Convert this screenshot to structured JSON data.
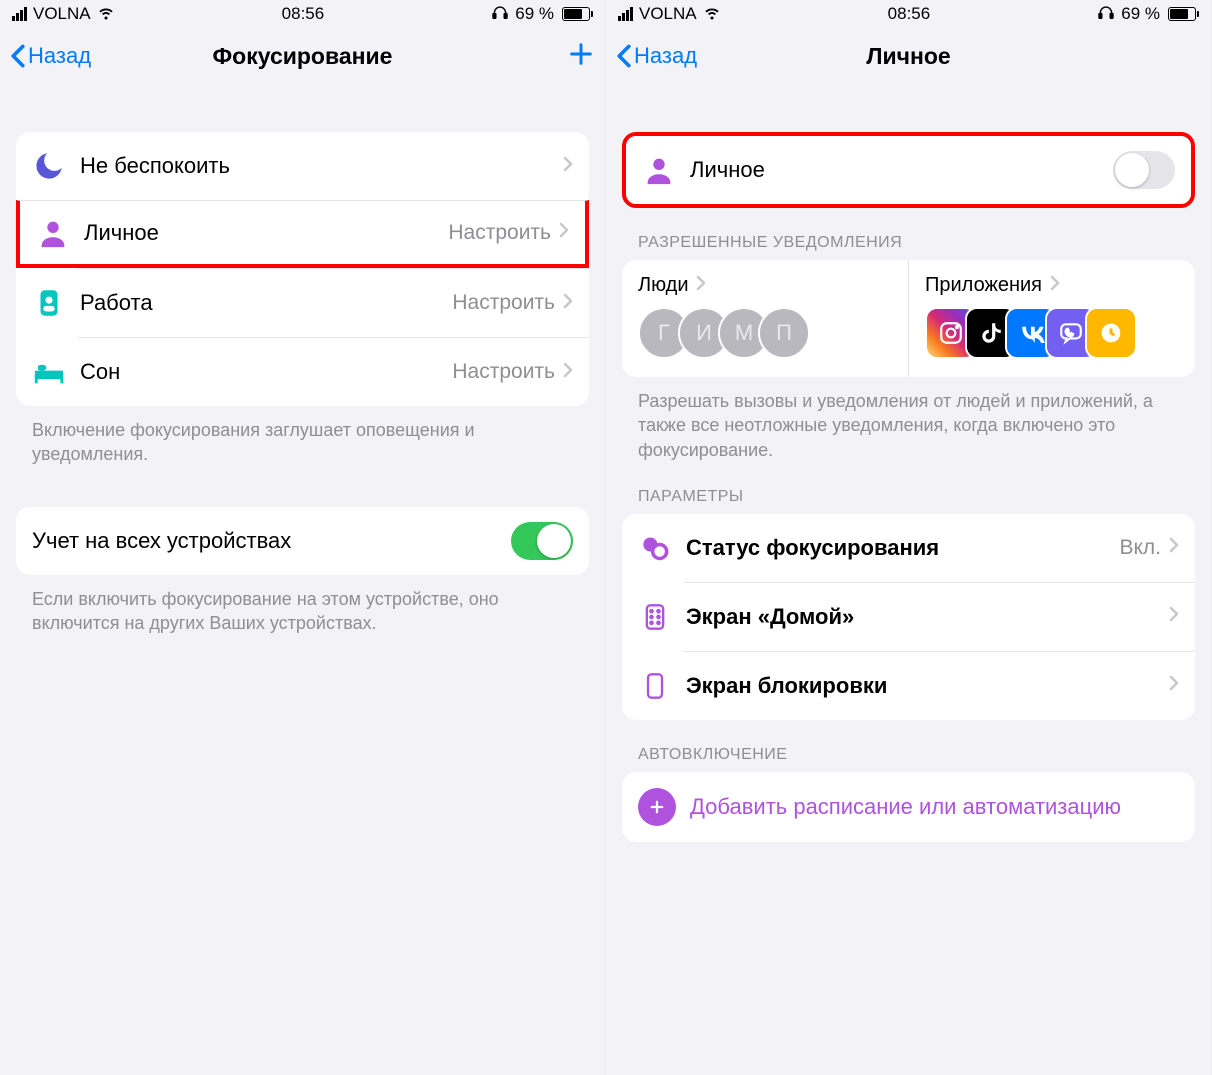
{
  "status": {
    "carrier": "VOLNA",
    "time": "08:56",
    "battery_pct": "69 %",
    "battery_fill": 69
  },
  "left": {
    "nav": {
      "back": "Назад",
      "title": "Фокусирование"
    },
    "focus_items": [
      {
        "label": "Не беспокоить",
        "detail": ""
      },
      {
        "label": "Личное",
        "detail": "Настроить"
      },
      {
        "label": "Работа",
        "detail": "Настроить"
      },
      {
        "label": "Сон",
        "detail": "Настроить"
      }
    ],
    "focus_footer": "Включение фокусирования заглушает оповещения и уведомления.",
    "sync_row": {
      "label": "Учет на всех устройствах"
    },
    "sync_footer": "Если включить фокусирование на этом устройстве, оно включится на других Ваших устройствах."
  },
  "right": {
    "nav": {
      "back": "Назад",
      "title": "Личное"
    },
    "toggle_row": {
      "label": "Личное"
    },
    "allowed_header": "РАЗРЕШЕННЫЕ УВЕДОМЛЕНИЯ",
    "allowed_people_label": "Люди",
    "allowed_apps_label": "Приложения",
    "people_initials": [
      "Г",
      "И",
      "М",
      "П"
    ],
    "allowed_footer": "Разрешать вызовы и уведомления от людей и приложений, а также все неотложные уведомления, когда включено это фокусирование.",
    "params_header": "ПАРАМЕТРЫ",
    "params": [
      {
        "label": "Статус фокусирования",
        "detail": "Вкл."
      },
      {
        "label": "Экран «Домой»",
        "detail": ""
      },
      {
        "label": "Экран блокировки",
        "detail": ""
      }
    ],
    "auto_header": "АВТОВКЛЮЧЕНИЕ",
    "add_schedule": "Добавить расписание или автоматизацию"
  }
}
